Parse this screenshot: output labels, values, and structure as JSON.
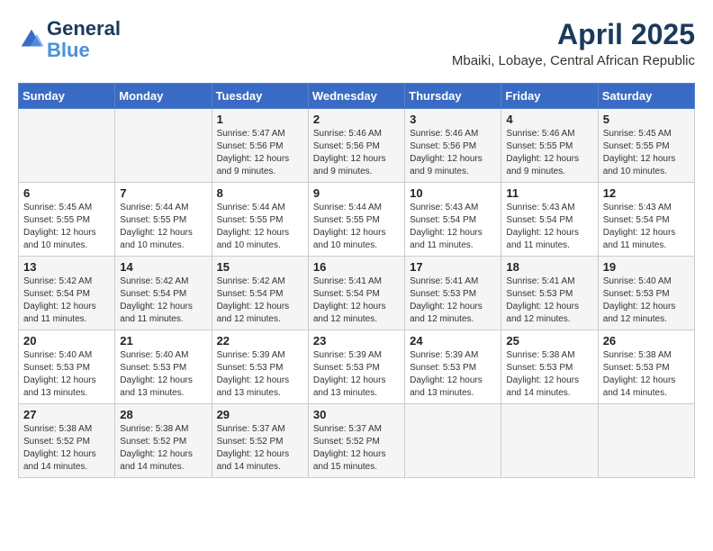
{
  "header": {
    "logo_line1": "General",
    "logo_line2": "Blue",
    "month_year": "April 2025",
    "location": "Mbaiki, Lobaye, Central African Republic"
  },
  "days_of_week": [
    "Sunday",
    "Monday",
    "Tuesday",
    "Wednesday",
    "Thursday",
    "Friday",
    "Saturday"
  ],
  "weeks": [
    [
      {
        "day": "",
        "info": ""
      },
      {
        "day": "",
        "info": ""
      },
      {
        "day": "1",
        "info": "Sunrise: 5:47 AM\nSunset: 5:56 PM\nDaylight: 12 hours\nand 9 minutes."
      },
      {
        "day": "2",
        "info": "Sunrise: 5:46 AM\nSunset: 5:56 PM\nDaylight: 12 hours\nand 9 minutes."
      },
      {
        "day": "3",
        "info": "Sunrise: 5:46 AM\nSunset: 5:56 PM\nDaylight: 12 hours\nand 9 minutes."
      },
      {
        "day": "4",
        "info": "Sunrise: 5:46 AM\nSunset: 5:55 PM\nDaylight: 12 hours\nand 9 minutes."
      },
      {
        "day": "5",
        "info": "Sunrise: 5:45 AM\nSunset: 5:55 PM\nDaylight: 12 hours\nand 10 minutes."
      }
    ],
    [
      {
        "day": "6",
        "info": "Sunrise: 5:45 AM\nSunset: 5:55 PM\nDaylight: 12 hours\nand 10 minutes."
      },
      {
        "day": "7",
        "info": "Sunrise: 5:44 AM\nSunset: 5:55 PM\nDaylight: 12 hours\nand 10 minutes."
      },
      {
        "day": "8",
        "info": "Sunrise: 5:44 AM\nSunset: 5:55 PM\nDaylight: 12 hours\nand 10 minutes."
      },
      {
        "day": "9",
        "info": "Sunrise: 5:44 AM\nSunset: 5:55 PM\nDaylight: 12 hours\nand 10 minutes."
      },
      {
        "day": "10",
        "info": "Sunrise: 5:43 AM\nSunset: 5:54 PM\nDaylight: 12 hours\nand 11 minutes."
      },
      {
        "day": "11",
        "info": "Sunrise: 5:43 AM\nSunset: 5:54 PM\nDaylight: 12 hours\nand 11 minutes."
      },
      {
        "day": "12",
        "info": "Sunrise: 5:43 AM\nSunset: 5:54 PM\nDaylight: 12 hours\nand 11 minutes."
      }
    ],
    [
      {
        "day": "13",
        "info": "Sunrise: 5:42 AM\nSunset: 5:54 PM\nDaylight: 12 hours\nand 11 minutes."
      },
      {
        "day": "14",
        "info": "Sunrise: 5:42 AM\nSunset: 5:54 PM\nDaylight: 12 hours\nand 11 minutes."
      },
      {
        "day": "15",
        "info": "Sunrise: 5:42 AM\nSunset: 5:54 PM\nDaylight: 12 hours\nand 12 minutes."
      },
      {
        "day": "16",
        "info": "Sunrise: 5:41 AM\nSunset: 5:54 PM\nDaylight: 12 hours\nand 12 minutes."
      },
      {
        "day": "17",
        "info": "Sunrise: 5:41 AM\nSunset: 5:53 PM\nDaylight: 12 hours\nand 12 minutes."
      },
      {
        "day": "18",
        "info": "Sunrise: 5:41 AM\nSunset: 5:53 PM\nDaylight: 12 hours\nand 12 minutes."
      },
      {
        "day": "19",
        "info": "Sunrise: 5:40 AM\nSunset: 5:53 PM\nDaylight: 12 hours\nand 12 minutes."
      }
    ],
    [
      {
        "day": "20",
        "info": "Sunrise: 5:40 AM\nSunset: 5:53 PM\nDaylight: 12 hours\nand 13 minutes."
      },
      {
        "day": "21",
        "info": "Sunrise: 5:40 AM\nSunset: 5:53 PM\nDaylight: 12 hours\nand 13 minutes."
      },
      {
        "day": "22",
        "info": "Sunrise: 5:39 AM\nSunset: 5:53 PM\nDaylight: 12 hours\nand 13 minutes."
      },
      {
        "day": "23",
        "info": "Sunrise: 5:39 AM\nSunset: 5:53 PM\nDaylight: 12 hours\nand 13 minutes."
      },
      {
        "day": "24",
        "info": "Sunrise: 5:39 AM\nSunset: 5:53 PM\nDaylight: 12 hours\nand 13 minutes."
      },
      {
        "day": "25",
        "info": "Sunrise: 5:38 AM\nSunset: 5:53 PM\nDaylight: 12 hours\nand 14 minutes."
      },
      {
        "day": "26",
        "info": "Sunrise: 5:38 AM\nSunset: 5:53 PM\nDaylight: 12 hours\nand 14 minutes."
      }
    ],
    [
      {
        "day": "27",
        "info": "Sunrise: 5:38 AM\nSunset: 5:52 PM\nDaylight: 12 hours\nand 14 minutes."
      },
      {
        "day": "28",
        "info": "Sunrise: 5:38 AM\nSunset: 5:52 PM\nDaylight: 12 hours\nand 14 minutes."
      },
      {
        "day": "29",
        "info": "Sunrise: 5:37 AM\nSunset: 5:52 PM\nDaylight: 12 hours\nand 14 minutes."
      },
      {
        "day": "30",
        "info": "Sunrise: 5:37 AM\nSunset: 5:52 PM\nDaylight: 12 hours\nand 15 minutes."
      },
      {
        "day": "",
        "info": ""
      },
      {
        "day": "",
        "info": ""
      },
      {
        "day": "",
        "info": ""
      }
    ]
  ]
}
